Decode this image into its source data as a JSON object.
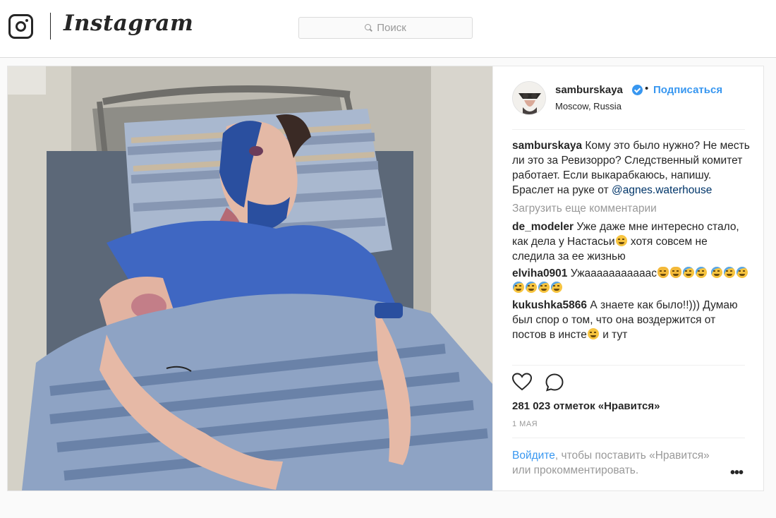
{
  "brand": {
    "wordmark": "Instagram",
    "logo_icon": "instagram-camera-icon"
  },
  "search": {
    "placeholder": "Поиск",
    "icon": "search-icon"
  },
  "post": {
    "photo_description": "photo",
    "author": {
      "username": "samburskaya",
      "verified": true,
      "separator": "•",
      "follow_label": "Подписаться",
      "location": "Moscow, Russia"
    },
    "caption": {
      "username": "samburskaya",
      "text": "Кому это было нужно? Не месть ли это за Ревизорро? Следственный комитет работает. Если выкарабкаюсь, напишу. Браслет на руке от ",
      "mention": "@agnes.waterhouse"
    },
    "load_more": "Загрузить еще комментарии",
    "comments": [
      {
        "username": "de_modeler",
        "text_before": "Уже даже мне интересно стало, как дела у Настасьи",
        "text_after": " хотя совсем не следила за ее жизнью"
      },
      {
        "username": "elviha0901",
        "text_before": "Ужааааааааааас",
        "text_after": ""
      },
      {
        "username": "kukushka5866",
        "text_before": "А знаете как было!!))) Думаю был спор о том, что она воздержится от постов в инсте",
        "text_after": " и тут"
      }
    ],
    "likes_label": "281 023 отметок «Нравится»",
    "date": "1 МАЯ",
    "login_link": "Войдите",
    "login_text": ", чтобы поставить «Нравится» или прокомментировать.",
    "more_options": "•••",
    "colors": {
      "accent": "#3897f0",
      "text": "#262626",
      "muted": "#999999",
      "border": "#dbdbdb"
    }
  }
}
